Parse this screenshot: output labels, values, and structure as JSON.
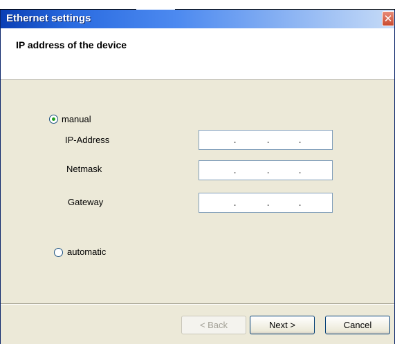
{
  "window": {
    "title": "Ethernet settings",
    "close_glyph": "✕"
  },
  "header": {
    "title": "IP address of the device"
  },
  "mode": {
    "manual_label": "manual",
    "manual_selected": true,
    "automatic_label": "automatic",
    "automatic_selected": false
  },
  "fields": [
    {
      "label": "IP-Address",
      "value": ". . ."
    },
    {
      "label": "Netmask",
      "value": ". . ."
    },
    {
      "label": "Gateway",
      "value": ". . ."
    }
  ],
  "buttons": {
    "back": "< Back",
    "next": "Next >",
    "cancel": "Cancel"
  },
  "colors": {
    "titlebar_start": "#0a3fb5",
    "window_bg": "#ece9d8",
    "radio_dot": "#21a121"
  },
  "icons": {
    "close": "close-icon",
    "radio": "radio-button"
  }
}
